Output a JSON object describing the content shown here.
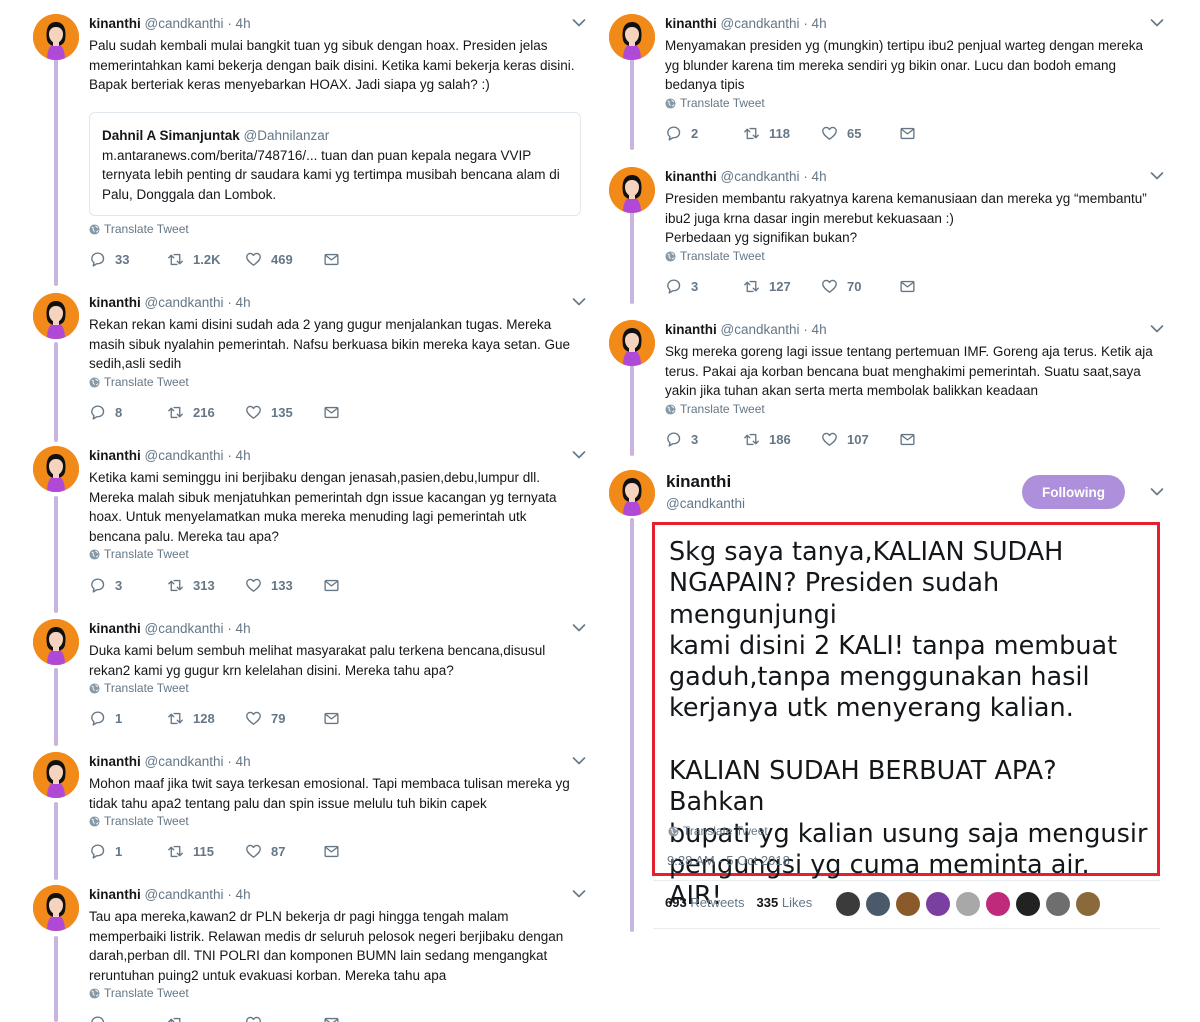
{
  "author": {
    "name": "kinanthi",
    "handle": "@candkanthi",
    "time": "· 4h"
  },
  "translate_label": "Translate Tweet",
  "left_tweets": [
    {
      "text": "Palu sudah kembali mulai bangkit tuan yg sibuk dengan hoax. Presiden jelas\nmemerintahkan kami bekerja dengan baik disini. Ketika kami bekerja keras disini.\nBapak berteriak keras menyebarkan HOAX. Jadi siapa yg salah? :)",
      "quote": {
        "name": "Dahnil A Simanjuntak",
        "handle": "@Dahnilanzar",
        "text": "m.antaranews.com/berita/748716/...  tuan dan puan kepala negara VVIP\nternyata lebih penting dr saudara kami yg tertimpa musibah bencana alam di\nPalu, Donggala dan Lombok."
      },
      "replies": "33",
      "retweets": "1.2K",
      "likes": "469"
    },
    {
      "text": "Rekan rekan kami disini sudah ada 2 yang gugur menjalankan tugas. Mereka\nmasih sibuk nyalahin pemerintah. Nafsu berkuasa bikin mereka kaya setan. Gue\nsedih,asli sedih",
      "replies": "8",
      "retweets": "216",
      "likes": "135"
    },
    {
      "text": "Ketika kami seminggu ini berjibaku dengan jenasah,pasien,debu,lumpur dll.\nMereka malah sibuk menjatuhkan pemerintah dgn issue kacangan yg ternyata\nhoax. Untuk menyelamatkan muka mereka menuding lagi pemerintah utk\nbencana palu. Mereka tau apa?",
      "replies": "3",
      "retweets": "313",
      "likes": "133"
    },
    {
      "text": "Duka kami belum sembuh melihat masyarakat palu terkena bencana,disusul\nrekan2 kami yg gugur krn kelelahan disini. Mereka tahu apa?",
      "replies": "1",
      "retweets": "128",
      "likes": "79"
    },
    {
      "text": "Mohon maaf jika twit saya terkesan emosional. Tapi membaca tulisan mereka yg\ntidak tahu apa2 tentang palu dan spin issue melulu tuh bikin capek",
      "replies": "1",
      "retweets": "115",
      "likes": "87"
    },
    {
      "text": "Tau apa mereka,kawan2 dr PLN bekerja dr pagi hingga tengah malam\nmemperbaiki listrik. Relawan medis dr seluruh pelosok negeri berjibaku dengan\ndarah,perban dll. TNI POLRI dan komponen BUMN lain sedang mengangkat\nreruntuhan puing2 untuk evakuasi korban. Mereka tahu apa"
    }
  ],
  "right_tweets": [
    {
      "text": "Menyamakan presiden yg (mungkin) tertipu ibu2 penjual warteg dengan mereka\nyg blunder karena tim mereka sendiri yg bikin onar. Lucu dan bodoh emang\nbedanya tipis",
      "replies": "2",
      "retweets": "118",
      "likes": "65"
    },
    {
      "text": "Presiden membantu rakyatnya karena kemanusiaan dan mereka yg “membantu”\nibu2 juga krna dasar ingin merebut kekuasaan :)\nPerbedaan yg signifikan bukan?",
      "replies": "3",
      "retweets": "127",
      "likes": "70"
    },
    {
      "text": "Skg mereka goreng lagi issue tentang pertemuan IMF. Goreng aja terus. Ketik aja\nterus. Pakai aja korban bencana buat menghakimi pemerintah. Suatu saat,saya\nyakin jika tuhan akan serta merta membolak balikkan keadaan",
      "replies": "3",
      "retweets": "186",
      "likes": "107"
    }
  ],
  "main_tweet": {
    "name": "kinanthi",
    "handle": "@candkanthi",
    "follow_label": "Following",
    "text": "Skg saya tanya,KALIAN SUDAH\nNGAPAIN? Presiden sudah mengunjungi\nkami disini 2 KALI! tanpa membuat\ngaduh,tanpa menggunakan hasil\nkerjanya utk menyerang kalian.\n\nKALIAN SUDAH BERBUAT APA? Bahkan\nbupati yg kalian usung saja mengusir\npengungsi yg cuma meminta air. AIR!",
    "timestamp": "9:28 AM - 5 Oct 2018",
    "retweets_count": "693",
    "retweets_label": "Retweets",
    "likes_count": "335",
    "likes_label": "Likes"
  },
  "colors": {
    "thread_line": "#c7b5e0",
    "avatar_bg": "#f28a1a",
    "follow_btn": "#ad8fdb",
    "highlight_border": "#e5202e",
    "muted": "#657786"
  },
  "liker_colors": [
    "#3b3b3b",
    "#4a5a6a",
    "#8b5a2b",
    "#7a3fa0",
    "#a8a8a8",
    "#c02a7a",
    "#222222",
    "#6e6e6e",
    "#8a6a3a"
  ]
}
